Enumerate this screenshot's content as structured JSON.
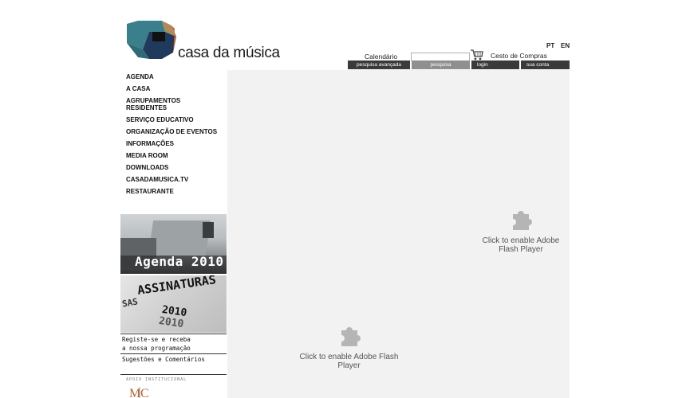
{
  "header": {
    "logo_text": "casa da música",
    "languages": [
      "PT",
      "EN"
    ],
    "calendario": "Calendário",
    "search": {
      "value": "",
      "placeholder": ""
    },
    "cesto": "Cesto de Compras",
    "bar": {
      "pesquisa_avancada": "pesquisa avançada",
      "pesquisa": "pesquisa",
      "login": "login",
      "sua_conta": "sua conta"
    }
  },
  "nav": {
    "items": [
      {
        "label": "AGENDA"
      },
      {
        "label": "A CASA"
      },
      {
        "label": "AGRUPAMENTOS RESIDENTES"
      },
      {
        "label": "SERVIÇO EDUCATIVO"
      },
      {
        "label": "ORGANIZAÇÃO DE EVENTOS"
      },
      {
        "label": "INFORMAÇÕES"
      },
      {
        "label": "MEDIA ROOM"
      },
      {
        "label": "DOWNLOADS"
      },
      {
        "label": "CASADAMUSICA.TV"
      },
      {
        "label": "RESTAURANTE"
      }
    ]
  },
  "banners": {
    "agenda": "Agenda 2010",
    "assinaturas": "ASSINATURAS",
    "assinaturas_year": "2010",
    "assinaturas_ghost": "SAS"
  },
  "side_links": {
    "registe_line1": "Registe-se e receba",
    "registe_line2": "a nossa programação",
    "sugestoes": "Sugestões e Comentários",
    "apoio": "APOIO INSTITUCIONAL"
  },
  "flash": {
    "message": "Click to enable Adobe Flash Player"
  },
  "colors": {
    "logo_teal": "#3b7f8c",
    "logo_navy": "#1f3a5c",
    "logo_tan": "#b08a5a",
    "logo_rust": "#b5643a",
    "bar_dark": "#3a3a3a",
    "bar_grey": "#8f8f8f",
    "flash_bg": "#f2f2f2"
  },
  "icons": {
    "cart": "shopping-cart-icon",
    "plugin": "puzzle-piece-icon"
  }
}
